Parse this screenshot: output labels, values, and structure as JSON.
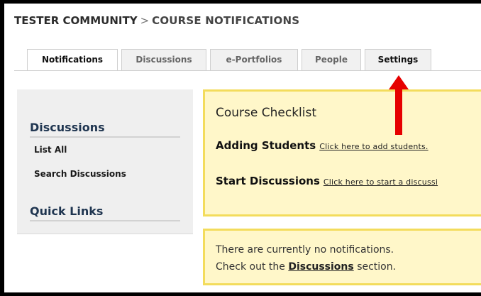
{
  "breadcrumb": {
    "community": "TESTER COMMUNITY",
    "separator": ">",
    "current": "COURSE NOTIFICATIONS"
  },
  "tabs": [
    {
      "label": "Notifications",
      "active": true
    },
    {
      "label": "Discussions",
      "active": false
    },
    {
      "label": "e-Portfolios",
      "active": false
    },
    {
      "label": "People",
      "active": false
    },
    {
      "label": "Settings",
      "active": false
    }
  ],
  "sidebar": {
    "discussions_title": "Discussions",
    "links": [
      "List All",
      "Search Discussions"
    ],
    "quick_links_title": "Quick Links"
  },
  "checklist": {
    "title": "Course Checklist",
    "items": [
      {
        "label": "Adding Students",
        "link": "Click here to add students."
      },
      {
        "label": "Start Discussions",
        "link": "Click here to start a discussi"
      }
    ]
  },
  "notifications": {
    "line1": "There are currently no notifications.",
    "line2_prefix": "Check out the",
    "line2_link": "Discussions",
    "line2_suffix": "section."
  },
  "colors": {
    "box_bg": "#fff7c9",
    "box_border": "#f3dc5c",
    "arrow": "#e60000",
    "sidebar_bg": "#efefef"
  }
}
